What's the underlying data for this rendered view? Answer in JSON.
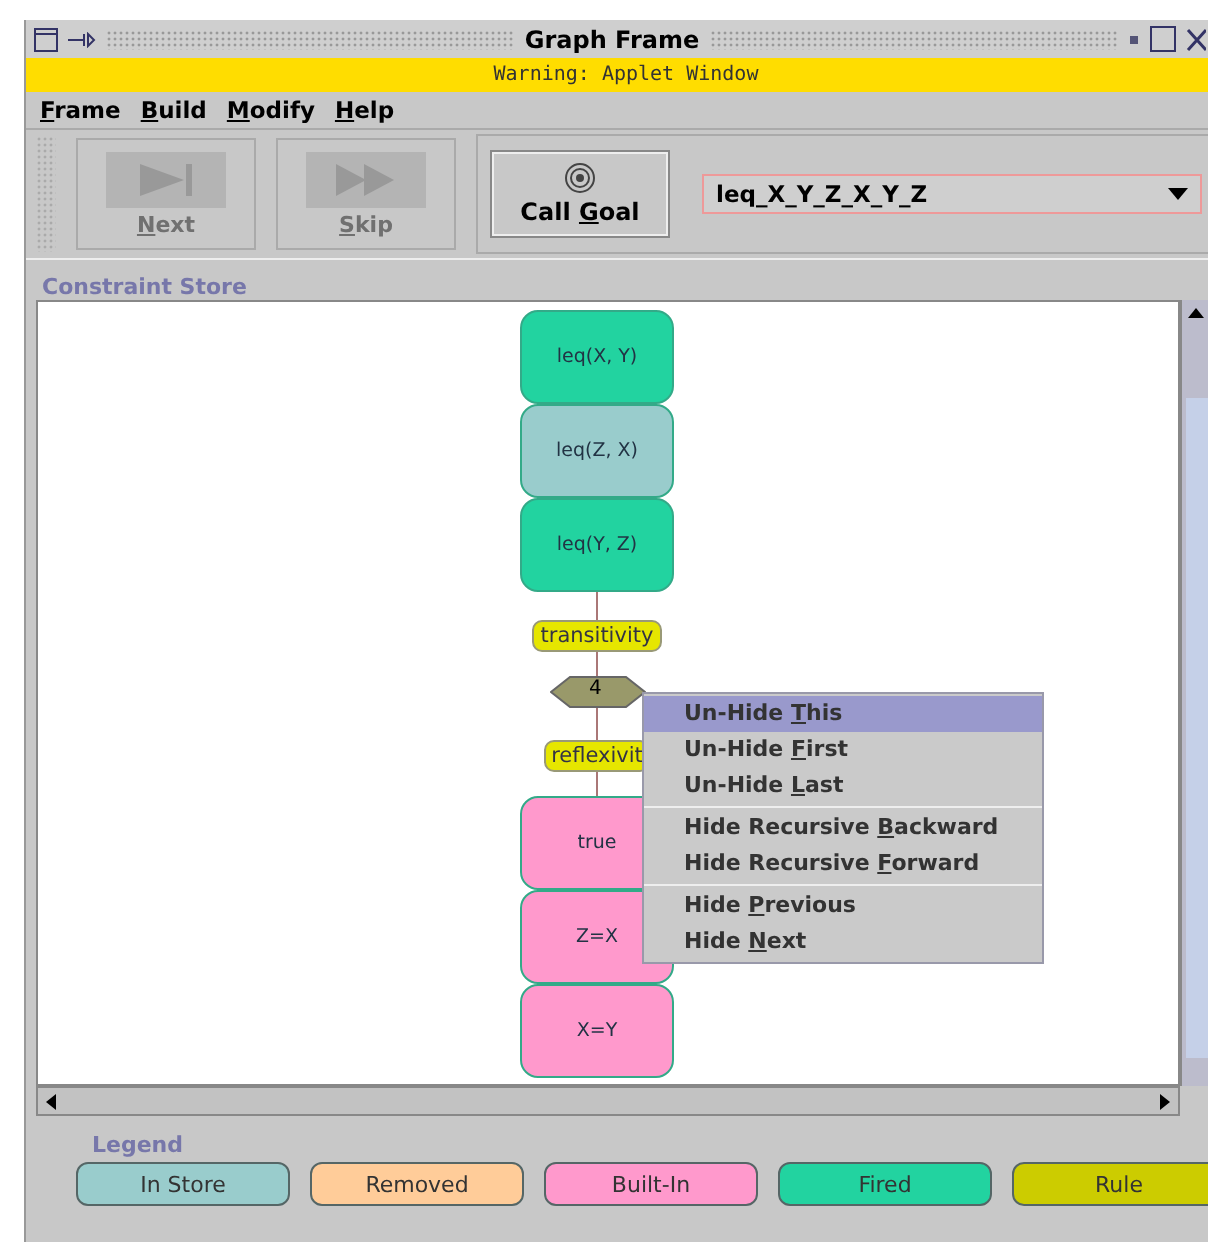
{
  "window": {
    "title": "Graph Frame",
    "warning": "Warning: Applet Window"
  },
  "menu": [
    {
      "mnemonic": "F",
      "after": "rame"
    },
    {
      "mnemonic": "B",
      "after": "uild"
    },
    {
      "mnemonic": "M",
      "after": "odify"
    },
    {
      "mnemonic": "H",
      "after": "elp"
    }
  ],
  "toolbar": {
    "buttons": [
      {
        "kind": "next",
        "mnemonic": "N",
        "after": "ext",
        "disabled": true
      },
      {
        "kind": "skip",
        "mnemonic": "S",
        "after": "kip",
        "disabled": true
      }
    ],
    "call_goal": {
      "before": "Call ",
      "mnemonic": "G",
      "after": "oal"
    },
    "goal_select": {
      "value": "leq_X_Y_Z_X_Y_Z"
    }
  },
  "constraint_store": {
    "title": "Constraint Store",
    "graph": [
      {
        "kind": "node",
        "label": "leq(X, Y)",
        "color": "#22d3a0"
      },
      {
        "kind": "node",
        "label": "leq(Z, X)",
        "color": "#99cccc"
      },
      {
        "kind": "node",
        "label": "leq(Y, Z)",
        "color": "#22d3a0"
      },
      {
        "kind": "rule",
        "label": "transitivity",
        "color": "#e6e600"
      },
      {
        "kind": "step",
        "label": "4"
      },
      {
        "kind": "rule",
        "label": "reflexivit",
        "color": "#e6e600"
      },
      {
        "kind": "node",
        "label": "true",
        "color": "#ff99cc"
      },
      {
        "kind": "node",
        "label": "Z=X",
        "color": "#ff99cc"
      },
      {
        "kind": "node",
        "label": "X=Y",
        "color": "#ff99cc"
      }
    ],
    "context_menu": {
      "groups": [
        {
          "items": [
            {
              "before": "Un-Hide ",
              "mnemonic": "T",
              "after": "his",
              "selected": true
            },
            {
              "before": "Un-Hide ",
              "mnemonic": "F",
              "after": "irst",
              "selected": false
            },
            {
              "before": "Un-Hide ",
              "mnemonic": "L",
              "after": "ast",
              "selected": false
            }
          ]
        },
        {
          "items": [
            {
              "before": "Hide Recursive ",
              "mnemonic": "B",
              "after": "ackward",
              "selected": false
            },
            {
              "before": "Hide Recursive ",
              "mnemonic": "F",
              "after": "orward",
              "selected": false
            }
          ]
        },
        {
          "items": [
            {
              "before": "Hide ",
              "mnemonic": "P",
              "after": "revious",
              "selected": false
            },
            {
              "before": "Hide ",
              "mnemonic": "N",
              "after": "ext",
              "selected": false
            }
          ]
        }
      ]
    }
  },
  "legend": {
    "title": "Legend",
    "items": [
      {
        "label": "In Store",
        "color": "#99cccc"
      },
      {
        "label": "Removed",
        "color": "#ffcc99"
      },
      {
        "label": "Built-In",
        "color": "#ff99cc"
      },
      {
        "label": "Fired",
        "color": "#22d3a0"
      },
      {
        "label": "Rule",
        "color": "#cccc00"
      }
    ]
  }
}
